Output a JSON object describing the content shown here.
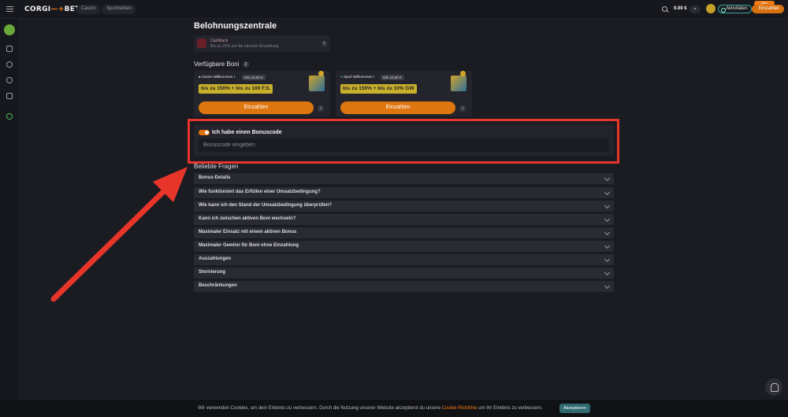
{
  "header": {
    "logo_left": "CORGI",
    "logo_right": "BET",
    "nav": [
      {
        "label": "Casino"
      },
      {
        "label": "Sportwetten"
      }
    ],
    "balance": "0.00 €",
    "activity_label": "Aktivitäten",
    "deposit_label": "Einzahlen",
    "new_badge": "Neu"
  },
  "page": {
    "title": "Belohnungszentrale"
  },
  "cashback": {
    "title": "Cashback",
    "subtitle": "Bis zu 20% auf die nächste Einzahlung",
    "info": "i"
  },
  "available_bonuses": {
    "title": "Verfügbare Boni",
    "count": "2",
    "cards": [
      {
        "tag": "Casino Willkommen I",
        "min": "Min 10,00 €",
        "highlight": "bis zu 150% + bis zu 100 F.S.",
        "button": "Einzahlen",
        "info": "i"
      },
      {
        "tag": "Sport Willkommen I",
        "min": "Min 10,00 €",
        "highlight": "bis zu 150% + bis zu 10% GW",
        "button": "Einzahlen",
        "info": "i"
      }
    ]
  },
  "promo": {
    "toggle_label": "Ich habe einen Bonuscode",
    "toggle_on": true,
    "input_placeholder": "Bonuscode eingeben",
    "input_value": ""
  },
  "faq": {
    "title": "Beliebte Fragen",
    "items": [
      {
        "label": "Bonus-Details"
      },
      {
        "label": "Wie funktioniert das Erfüllen einer Umsatzbedingung?"
      },
      {
        "label": "Wie kann ich den Stand der Umsatzbedingung überprüfen?"
      },
      {
        "label": "Kann ich zwischen aktiven Boni wechseln?"
      },
      {
        "label": "Maximaler Einsatz mit einem aktiven Bonus"
      },
      {
        "label": "Maximaler Gewinn für Boni ohne Einzahlung"
      },
      {
        "label": "Auszahlungen"
      },
      {
        "label": "Stornierung"
      },
      {
        "label": "Beschränkungen"
      }
    ]
  },
  "cookie": {
    "text_before": "Wir verwenden Cookies, um dein Erlebnis zu verbessern. Durch die Nutzung unserer Website akzeptierst du unsere ",
    "link": "Cookie-Richtlinie",
    "text_after": " um Ihr Erlebnis zu verbessern.",
    "accept": "Akzeptieren"
  },
  "colors": {
    "accent": "#f07c15",
    "annotation": "#e8352a",
    "background": "#1b1c22"
  }
}
